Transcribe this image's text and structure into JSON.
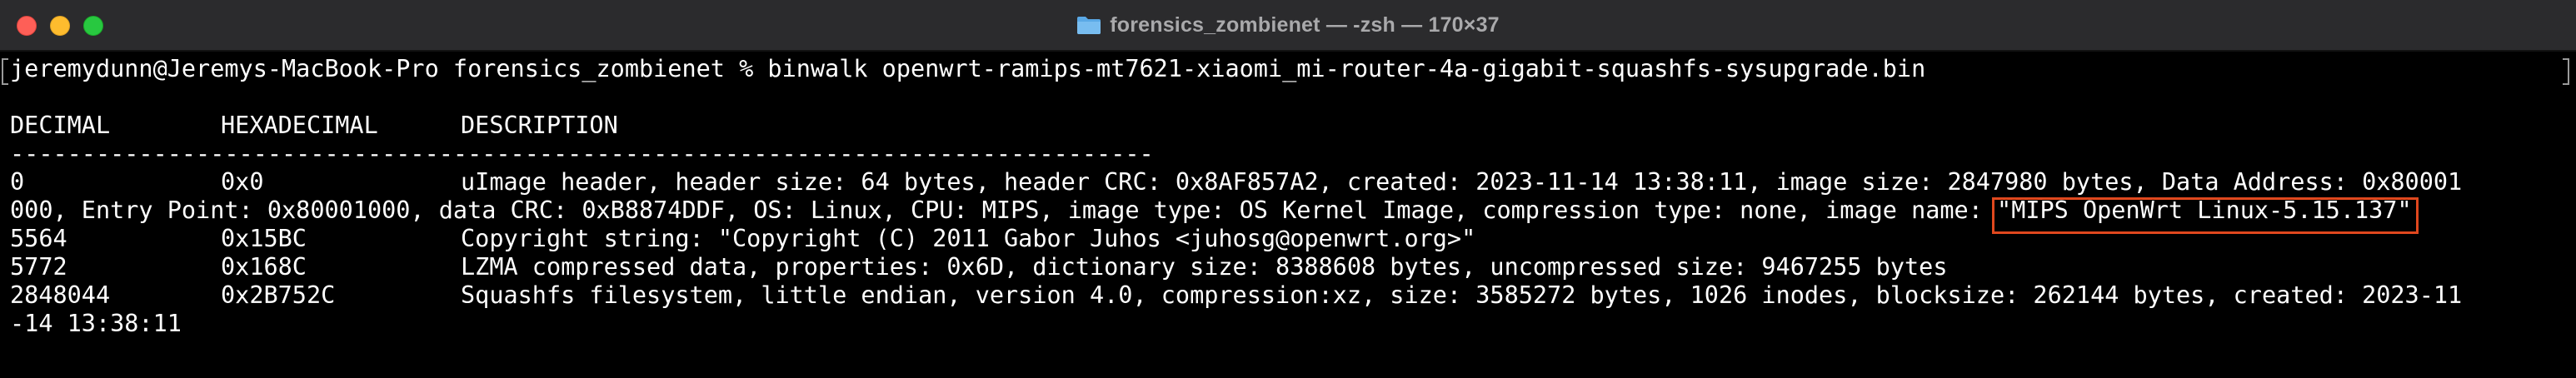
{
  "window": {
    "title": "forensics_zombienet — -zsh — 170×37",
    "icon": "folder-icon",
    "accent_colors": {
      "close": "#fe5f57",
      "minimize": "#febc2e",
      "maximize": "#28c840",
      "highlight": "#e0481e"
    }
  },
  "terminal": {
    "prompt": "jeremydunn@Jeremys-MacBook-Pro forensics_zombienet % ",
    "command": "binwalk openwrt-ramips-mt7621-xiaomi_mi-router-4a-gigabit-squashfs-sysupgrade.bin",
    "headers": {
      "decimal": "DECIMAL",
      "hexadecimal": "HEXADECIMAL",
      "description": "DESCRIPTION"
    },
    "separator": "--------------------------------------------------------------------------------",
    "rows": [
      {
        "decimal": "0",
        "hex": "0x0",
        "description": "uImage header, header size: 64 bytes, header CRC: 0x8AF857A2, created: 2023-11-14 13:38:11, image size: 2847980 bytes, Data Address: 0x80001",
        "wrap_before": "000, Entry Point: 0x80001000, data CRC: 0xB8874DDF, OS: Linux, CPU: MIPS, image type: OS Kernel Image, compression type: none, image name: ",
        "wrap_highlight": "\"MIPS OpenWrt Linux-5.15.137\""
      },
      {
        "decimal": "5564",
        "hex": "0x15BC",
        "description": "Copyright string: \"Copyright (C) 2011 Gabor Juhos <juhosg@openwrt.org>\""
      },
      {
        "decimal": "5772",
        "hex": "0x168C",
        "description": "LZMA compressed data, properties: 0x6D, dictionary size: 8388608 bytes, uncompressed size: 9467255 bytes"
      },
      {
        "decimal": "2848044",
        "hex": "0x2B752C",
        "description": "Squashfs filesystem, little endian, version 4.0, compression:xz, size: 3585272 bytes, 1026 inodes, blocksize: 262144 bytes, created: 2023-11",
        "wrap": "-14 13:38:11"
      }
    ]
  }
}
